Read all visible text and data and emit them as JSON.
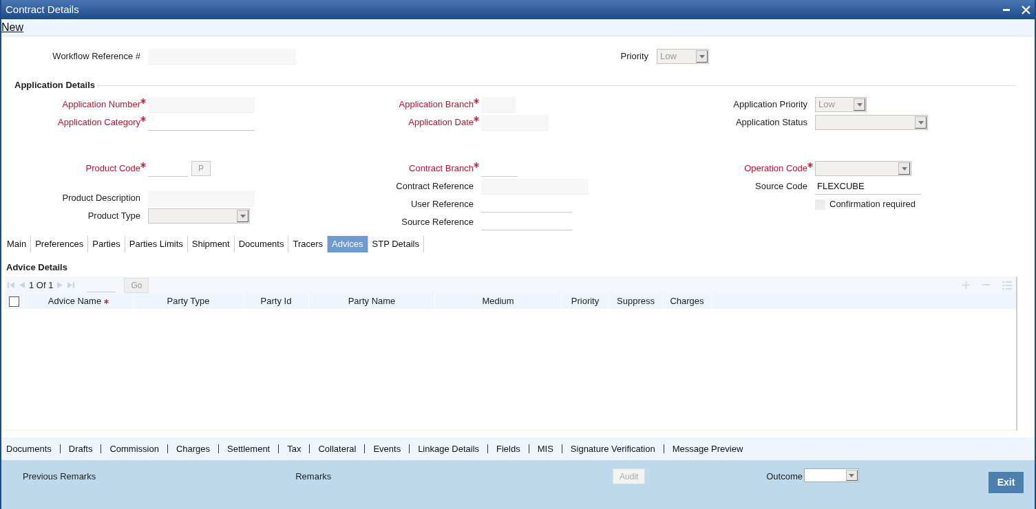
{
  "window": {
    "title": "Contract Details"
  },
  "toolbar": {
    "link": "New"
  },
  "workflow": {
    "label": "Workflow Reference #",
    "priority_label": "Priority",
    "priority_value": "Low"
  },
  "section_title": "Application Details",
  "application_columns": [
    [
      {
        "label": "Application Number",
        "required": true,
        "kind": "text",
        "readonly": true
      },
      {
        "label": "Application Category",
        "required": true,
        "kind": "text",
        "readonly": false
      }
    ],
    [
      {
        "label": "Application Branch",
        "required": true,
        "kind": "text",
        "readonly": true
      },
      {
        "label": "Application Date",
        "required": true,
        "kind": "text",
        "readonly": true
      }
    ],
    [
      {
        "label": "Application Priority",
        "required": false,
        "kind": "select",
        "value": "Low"
      },
      {
        "label": "Application Status",
        "required": false,
        "kind": "select"
      }
    ]
  ],
  "contract_columns": [
    [
      {
        "label": "Product Code",
        "required": true,
        "kind": "lookup",
        "readonly": false,
        "button": "P"
      },
      {
        "label": "Product Description",
        "required": false,
        "kind": "text",
        "readonly": true
      },
      {
        "label": "Product Type",
        "required": false,
        "kind": "select"
      }
    ],
    [
      {
        "label": "Contract Branch",
        "required": true,
        "kind": "text",
        "readonly": false
      },
      {
        "label": "Contract Reference",
        "required": false,
        "kind": "text",
        "readonly": true
      },
      {
        "label": "User Reference",
        "required": false,
        "kind": "text",
        "readonly": false
      },
      {
        "label": "Source Reference",
        "required": false,
        "kind": "text",
        "readonly": false
      }
    ],
    [
      {
        "label": "Operation Code",
        "required": true,
        "kind": "select"
      },
      {
        "label": "Source Code",
        "required": false,
        "kind": "text",
        "readonly": false,
        "value": "FLEXCUBE"
      },
      {
        "label": "Confirmation required",
        "required": false,
        "kind": "checkbox",
        "checked": false
      }
    ]
  ],
  "tabs": [
    {
      "label": "Main",
      "selected": false
    },
    {
      "label": "Preferences",
      "selected": false
    },
    {
      "label": "Parties",
      "selected": false
    },
    {
      "label": "Parties Limits",
      "selected": false
    },
    {
      "label": "Shipment",
      "selected": false
    },
    {
      "label": "Documents",
      "selected": false
    },
    {
      "label": "Tracers",
      "selected": false
    },
    {
      "label": "Advices",
      "selected": true
    },
    {
      "label": "STP Details",
      "selected": false
    }
  ],
  "advice_grid": {
    "title": "Advice Details",
    "page": "1 Of 1",
    "go": "Go",
    "select_all_checked": false,
    "columns": [
      {
        "label": "Advice Name",
        "required": true
      },
      {
        "label": "Party Type",
        "required": false
      },
      {
        "label": "Party Id",
        "required": false
      },
      {
        "label": "Party Name",
        "required": false
      },
      {
        "label": "Medium",
        "required": false
      },
      {
        "label": "Priority",
        "required": false
      },
      {
        "label": "Suppress",
        "required": false
      },
      {
        "label": "Charges",
        "required": false
      }
    ]
  },
  "footer_links": [
    "Documents",
    "Drafts",
    "Commission",
    "Charges",
    "Settlement",
    "Tax",
    "Collateral",
    "Events",
    "Linkage Details",
    "Fields",
    "MIS",
    "Signature Verification",
    "Message Preview"
  ],
  "bottom_bar": {
    "previous_remarks": "Previous Remarks",
    "remarks": "Remarks",
    "audit": "Audit",
    "outcome_label": "Outcome",
    "exit": "Exit"
  }
}
